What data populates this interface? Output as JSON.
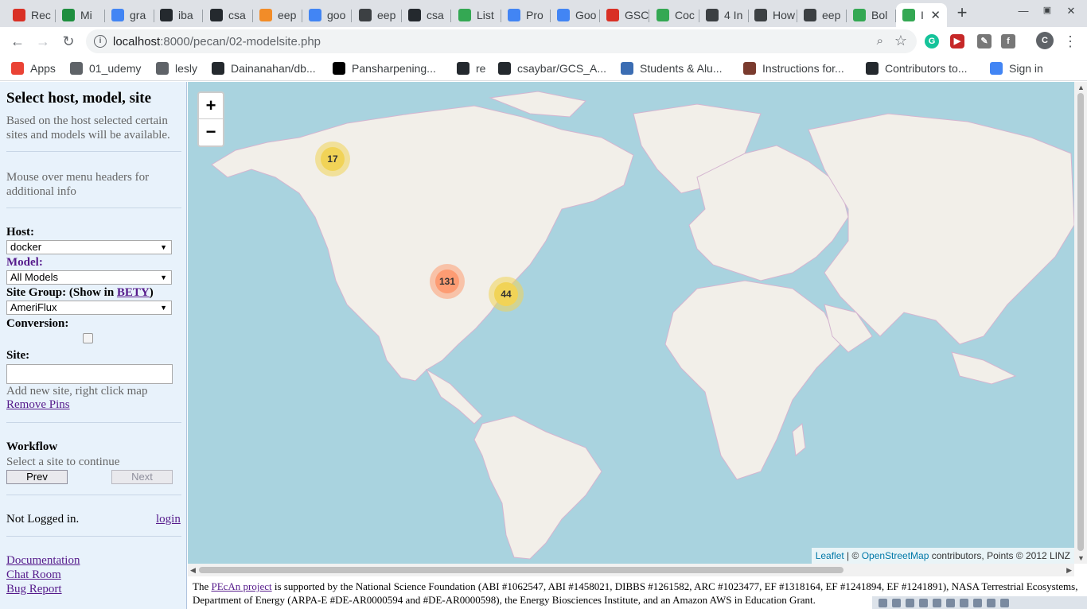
{
  "browser": {
    "tabs": [
      {
        "label": "Rec",
        "icon": "gmail-icon",
        "color": "#d93025"
      },
      {
        "label": "Mi",
        "icon": "drive-icon",
        "color": "#1e8e3e"
      },
      {
        "label": "gra",
        "icon": "google-icon",
        "color": "#4285f4"
      },
      {
        "label": "iba",
        "icon": "github-icon",
        "color": "#24292e"
      },
      {
        "label": "csa",
        "icon": "github-icon",
        "color": "#24292e"
      },
      {
        "label": "eep",
        "icon": "app-icon",
        "color": "#f28c28"
      },
      {
        "label": "goo",
        "icon": "google-icon",
        "color": "#4285f4"
      },
      {
        "label": "eep",
        "icon": "globe-icon",
        "color": "#3c4043"
      },
      {
        "label": "csa",
        "icon": "github-icon",
        "color": "#24292e"
      },
      {
        "label": "List",
        "icon": "leaf-icon",
        "color": "#34a853"
      },
      {
        "label": "Pro",
        "icon": "docs-icon",
        "color": "#4285f4"
      },
      {
        "label": "Goo",
        "icon": "translate-icon",
        "color": "#4285f4"
      },
      {
        "label": "GSC",
        "icon": "gmail-icon",
        "color": "#d93025"
      },
      {
        "label": "Coc",
        "icon": "leaf-icon",
        "color": "#34a853"
      },
      {
        "label": "4 In",
        "icon": "globe-icon",
        "color": "#3c4043"
      },
      {
        "label": "How",
        "icon": "globe-icon",
        "color": "#3c4043"
      },
      {
        "label": "eep",
        "icon": "globe-icon",
        "color": "#3c4043"
      },
      {
        "label": "Bol",
        "icon": "leaf-icon",
        "color": "#34a853"
      },
      {
        "label": "I",
        "icon": "leaf-icon",
        "color": "#34a853",
        "active": true
      }
    ],
    "url_host": "localhost",
    "url_path": ":8000/pecan/02-modelsite.php",
    "profile_initial": "C",
    "bookmarks": [
      {
        "label": "Apps",
        "icon": "apps-icon",
        "color": "#ea4335"
      },
      {
        "label": "01_udemy",
        "icon": "folder-icon",
        "color": "#5f6368"
      },
      {
        "label": "lesly",
        "icon": "folder-icon",
        "color": "#5f6368"
      },
      {
        "label": "Dainanahan/db...",
        "icon": "github-icon",
        "color": "#24292e"
      },
      {
        "label": "Pansharpening...",
        "icon": "wix-icon",
        "color": "#000000"
      },
      {
        "label": "re",
        "icon": "github-icon",
        "color": "#24292e"
      },
      {
        "label": "csaybar/GCS_A...",
        "icon": "github-icon",
        "color": "#24292e"
      },
      {
        "label": "Students & Alu...",
        "icon": "globe-icon",
        "color": "#3b6db3"
      },
      {
        "label": "Instructions for...",
        "icon": "image-icon",
        "color": "#7a3b2e"
      },
      {
        "label": "Contributors to...",
        "icon": "github-icon",
        "color": "#24292e"
      },
      {
        "label": "Sign in",
        "icon": "google-icon",
        "color": "#4285f4"
      }
    ]
  },
  "panel": {
    "title": "Select host, model, site",
    "intro": "Based on the host selected certain sites and models will be available.",
    "hint": "Mouse over menu headers for additional info",
    "host_label": "Host:",
    "host_value": "docker",
    "model_label": "Model:",
    "model_value": "All Models",
    "sitegroup_label": "Site Group: (Show in ",
    "sitegroup_link": "BETY",
    "sitegroup_close": ")",
    "sitegroup_value": "AmeriFlux",
    "conversion_label": "Conversion:",
    "site_label": "Site:",
    "site_value": "",
    "add_site_hint": "Add new site, right click map",
    "remove_pins": "Remove Pins",
    "workflow_title": "Workflow",
    "workflow_hint": "Select a site to continue",
    "prev_label": "Prev",
    "next_label": "Next",
    "login_status": "Not Logged in.",
    "login_link": "login",
    "links": [
      "Documentation",
      "Chat Room",
      "Bug Report"
    ]
  },
  "map": {
    "zoom_in": "+",
    "zoom_out": "−",
    "clusters": [
      {
        "count": "17",
        "color": "#f1d357"
      },
      {
        "count": "131",
        "color": "#fd9c73"
      },
      {
        "count": "44",
        "color": "#f1d357"
      }
    ],
    "attribution_leaflet": "Leaflet",
    "attribution_sep": " | © ",
    "attribution_osm": "OpenStreetMap",
    "attribution_rest": " contributors, Points © 2012 LINZ"
  },
  "footer": {
    "prefix": "The ",
    "link": "PEcAn project",
    "text": " is supported by the National Science Foundation (ABI #1062547, ABI #1458021, DIBBS #1261582, ARC #1023477, EF #1318164, EF #1241894, EF #1241891), NASA Terrestrial Ecosystems, Department of Energy (ARPA-E #DE-AR0000594 and #DE-AR0000598), the Energy Biosciences Institute, and an Amazon AWS in Education Grant."
  }
}
